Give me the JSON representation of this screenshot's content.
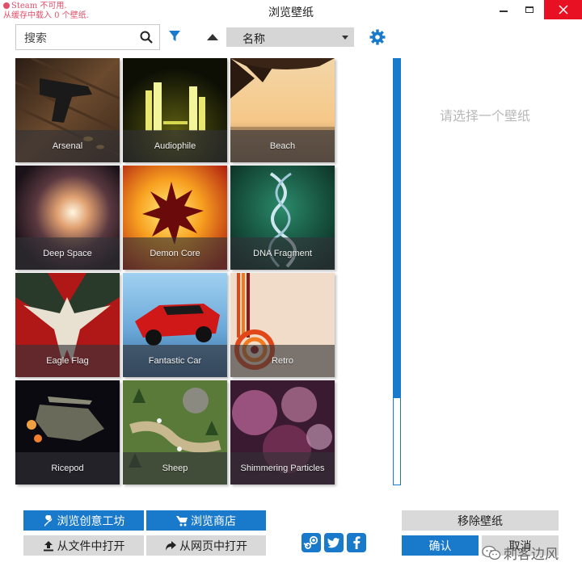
{
  "window": {
    "title": "浏览壁纸",
    "status_line_1": "Steam 不可用.",
    "status_line_2": "从缓存中载入 0 个壁纸."
  },
  "toolbar": {
    "search_placeholder": "搜索",
    "sort_by": "名称"
  },
  "wallpapers": [
    {
      "name": "Arsenal"
    },
    {
      "name": "Audiophile"
    },
    {
      "name": "Beach"
    },
    {
      "name": "Deep Space"
    },
    {
      "name": "Demon Core"
    },
    {
      "name": "DNA Fragment"
    },
    {
      "name": "Eagle Flag"
    },
    {
      "name": "Fantastic Car"
    },
    {
      "name": "Retro"
    },
    {
      "name": "Ricepod"
    },
    {
      "name": "Sheep"
    },
    {
      "name": "Shimmering Particles"
    }
  ],
  "preview": {
    "empty_message": "请选择一个壁纸"
  },
  "buttons": {
    "workshop": "浏览创意工坊",
    "store": "浏览商店",
    "open_file": "从文件中打开",
    "open_web": "从网页中打开",
    "remove": "移除壁纸",
    "confirm": "确认",
    "cancel": "取消"
  },
  "watermark": "刺客边风",
  "colors": {
    "accent": "#1979ca",
    "close": "#e81123",
    "status_text": "#e0506a"
  }
}
